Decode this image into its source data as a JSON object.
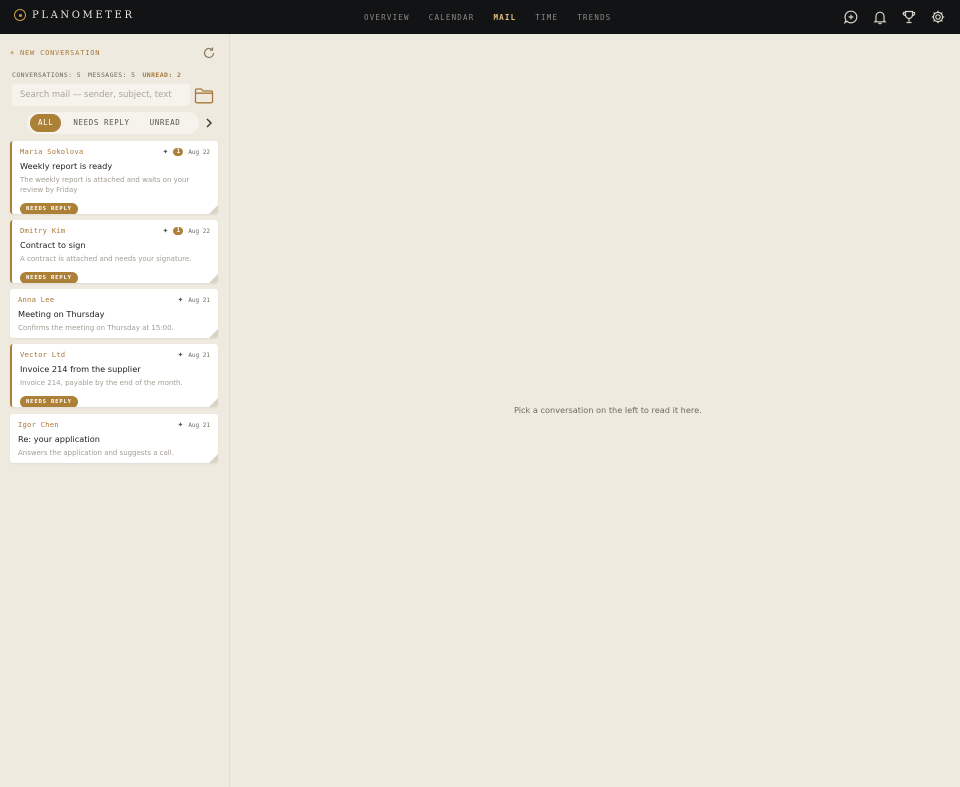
{
  "brand": {
    "name": "PLANOMETER"
  },
  "nav": [
    {
      "label": "OVERVIEW",
      "active": false
    },
    {
      "label": "CALENDAR",
      "active": false
    },
    {
      "label": "MAIL",
      "active": true
    },
    {
      "label": "TIME",
      "active": false
    },
    {
      "label": "TRENDS",
      "active": false
    }
  ],
  "top_icons": [
    "compose-chat-icon",
    "bell-icon",
    "trophy-icon",
    "gear-icon"
  ],
  "sidebar": {
    "new_conversation": "+ NEW CONVERSATION",
    "stats": {
      "conversations": "CONVERSATIONS: 5",
      "messages": "MESSAGES: 5",
      "unread": "UNREAD: 2"
    },
    "search_placeholder": "Search mail — sender, subject, text",
    "filters": [
      {
        "label": "ALL",
        "active": true
      },
      {
        "label": "NEEDS REPLY",
        "active": false
      },
      {
        "label": "UNREAD",
        "active": false
      }
    ]
  },
  "conversations": [
    {
      "sender": "Maria Sokolova",
      "subject": "Weekly report is ready",
      "preview": "The weekly report is attached and waits on your review by Friday",
      "date": "Aug 22",
      "count": "1",
      "unread": true,
      "tag": "NEEDS REPLY"
    },
    {
      "sender": "Dmitry Kim",
      "subject": "Contract to sign",
      "preview": "A contract is attached and needs your signature.",
      "date": "Aug 22",
      "count": "1",
      "unread": true,
      "tag": "NEEDS REPLY"
    },
    {
      "sender": "Anna Lee",
      "subject": "Meeting on Thursday",
      "preview": "Confirms the meeting on Thursday at 15:00.",
      "date": "Aug 21",
      "count": "",
      "unread": false,
      "tag": ""
    },
    {
      "sender": "Vector Ltd",
      "subject": "Invoice 214 from the supplier",
      "preview": "Invoice 214, payable by the end of the month.",
      "date": "Aug 21",
      "count": "",
      "unread": false,
      "tag": "NEEDS REPLY"
    },
    {
      "sender": "Igor Chen",
      "subject": "Re: your application",
      "preview": "Answers the application and suggests a call.",
      "date": "Aug 21",
      "count": "",
      "unread": false,
      "tag": ""
    }
  ],
  "main": {
    "empty_text": "Pick a conversation on the left to read it here."
  },
  "colors": {
    "accent": "#ad8038",
    "topbar": "#121315",
    "background": "#eeeae0"
  }
}
